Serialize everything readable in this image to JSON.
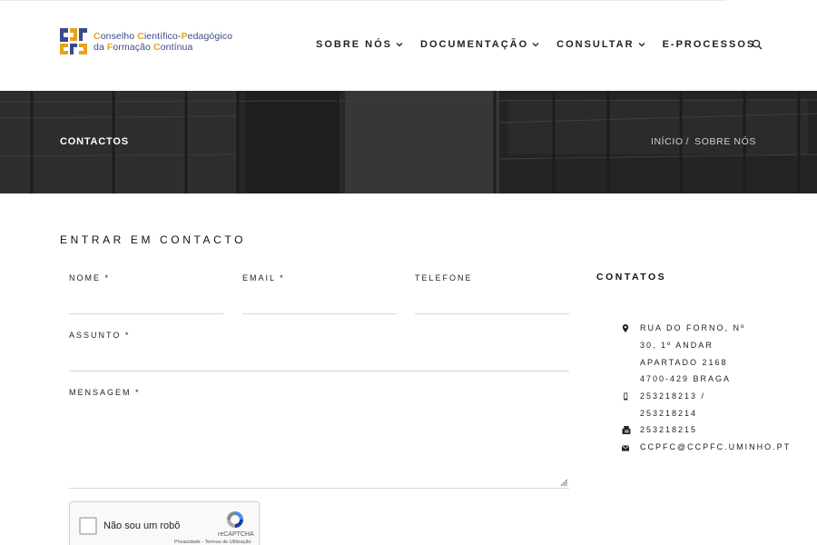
{
  "header": {
    "logo": {
      "line1": {
        "c1": "C",
        "t1": "onselho ",
        "c2": "C",
        "t2": "ientífico-",
        "c3": "P",
        "t3": "edagógico"
      },
      "line2": {
        "t1": "da ",
        "c1": "F",
        "t2": "ormação ",
        "c2": "C",
        "t3": "ontínua"
      }
    },
    "nav": [
      {
        "label": "SOBRE NÓS",
        "has_dropdown": true
      },
      {
        "label": "DOCUMENTAÇÃO",
        "has_dropdown": true
      },
      {
        "label": "CONSULTAR",
        "has_dropdown": true
      },
      {
        "label": "E-PROCESSOS",
        "has_dropdown": false
      }
    ],
    "search_icon": "search-icon"
  },
  "banner": {
    "title": "CONTACTOS",
    "breadcrumb": [
      "INÍCIO",
      "SOBRE NÓS"
    ],
    "separator": "/"
  },
  "form": {
    "title": "ENTRAR EM CONTACTO",
    "fields": {
      "nome": {
        "label": "NOME *",
        "value": ""
      },
      "email": {
        "label": "EMAIL *",
        "value": ""
      },
      "telefone": {
        "label": "TELEFONE",
        "value": ""
      },
      "assunto": {
        "label": "ASSUNTO *",
        "value": ""
      },
      "mensagem": {
        "label": "MENSAGEM *",
        "value": ""
      }
    },
    "captcha": {
      "label": "Não sou um robô",
      "brand": "reCAPTCHA",
      "links": "Privacidade - Termos de Utilização"
    }
  },
  "contacts": {
    "title": "CONTATOS",
    "address": [
      "RUA DO FORNO, Nº",
      "30, 1º ANDAR",
      "APARTADO 2168",
      "4700-429 BRAGA"
    ],
    "phone": [
      "253218213 /",
      "253218214"
    ],
    "fax": "253218215",
    "email": "CCPFC@CCPFC.UMINHO.PT",
    "icons": [
      "map-pin-icon",
      "mobile-phone-icon",
      "fax-icon",
      "envelope-icon"
    ]
  },
  "colors": {
    "logo_blue": "#3a4a8a",
    "logo_gold": "#e6a31c",
    "banner_dark": "#333333"
  }
}
